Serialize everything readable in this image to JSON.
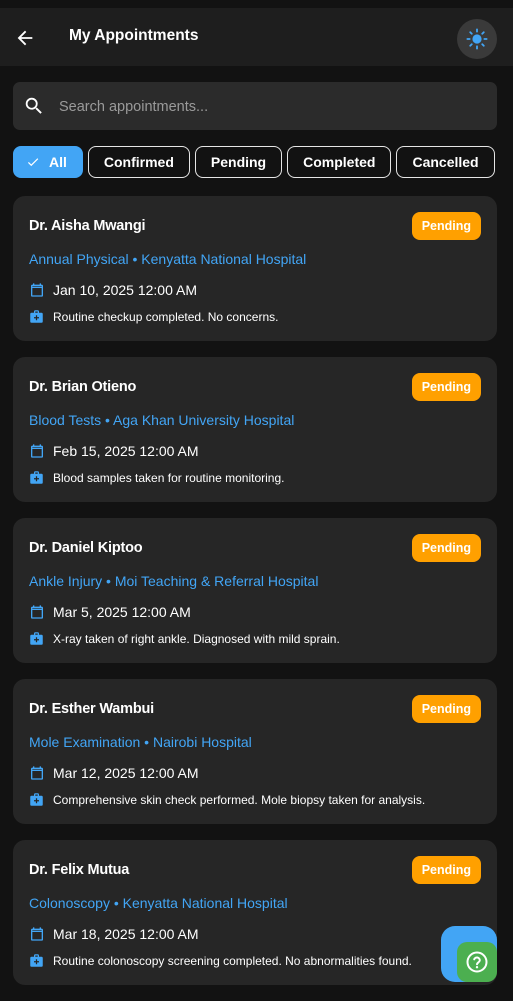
{
  "appbar": {
    "title": "My Appointments",
    "back_icon": "arrow-left-icon",
    "theme_icon": "sun-icon"
  },
  "search": {
    "placeholder": "Search appointments...",
    "value": ""
  },
  "filters": [
    {
      "label": "All",
      "active": true
    },
    {
      "label": "Confirmed",
      "active": false
    },
    {
      "label": "Pending",
      "active": false
    },
    {
      "label": "Completed",
      "active": false
    },
    {
      "label": "Cancelled",
      "active": false
    }
  ],
  "appointments": [
    {
      "doctor": "Dr. Aisha Mwangi",
      "status": "Pending",
      "subtitle": "Annual Physical • Kenyatta National Hospital",
      "datetime": "Jan 10, 2025 12:00 AM",
      "note": "Routine checkup completed. No concerns."
    },
    {
      "doctor": "Dr. Brian Otieno",
      "status": "Pending",
      "subtitle": "Blood Tests • Aga Khan University Hospital",
      "datetime": "Feb 15, 2025 12:00 AM",
      "note": "Blood samples taken for routine monitoring."
    },
    {
      "doctor": "Dr. Daniel Kiptoo",
      "status": "Pending",
      "subtitle": "Ankle Injury • Moi Teaching & Referral Hospital",
      "datetime": "Mar 5, 2025 12:00 AM",
      "note": "X-ray taken of right ankle. Diagnosed with mild sprain."
    },
    {
      "doctor": "Dr. Esther Wambui",
      "status": "Pending",
      "subtitle": "Mole Examination • Nairobi Hospital",
      "datetime": "Mar 12, 2025 12:00 AM",
      "note": "Comprehensive skin check performed. Mole biopsy taken for analysis."
    },
    {
      "doctor": "Dr. Felix Mutua",
      "status": "Pending",
      "subtitle": "Colonoscopy • Kenyatta National Hospital",
      "datetime": "Mar 18, 2025 12:00 AM",
      "note": "Routine colonoscopy screening completed. No abnormalities found."
    }
  ],
  "colors": {
    "accent": "#42a5f5",
    "pending": "#ffa000",
    "help_fab": "#4caf50",
    "background": "#121212",
    "card": "#262626"
  },
  "icons": {
    "calendar": "calendar-icon",
    "medical": "medical-bag-icon",
    "search": "search-icon",
    "help": "help-circle-icon",
    "check": "check-icon"
  }
}
